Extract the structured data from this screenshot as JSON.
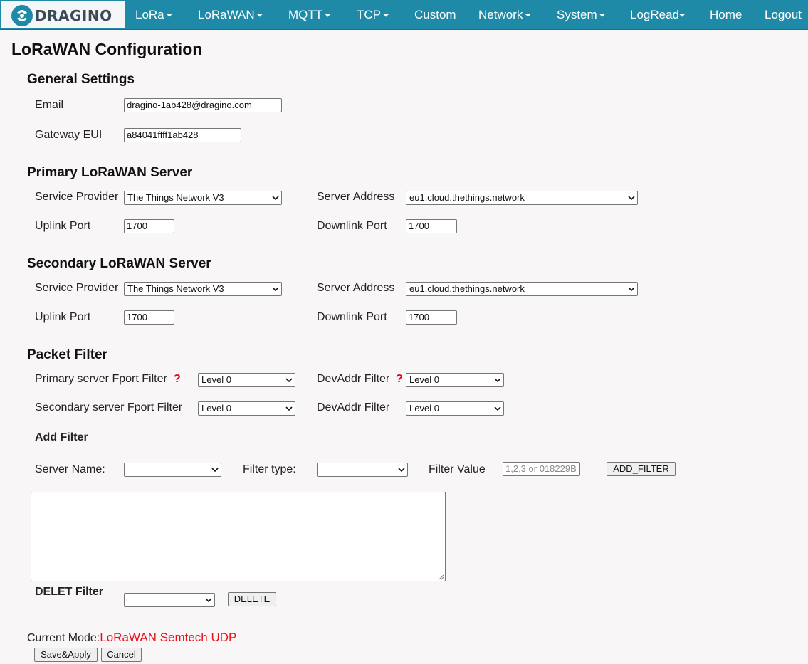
{
  "brand": {
    "logo_text": "DRAGINO"
  },
  "nav": {
    "items": [
      {
        "label": "LoRa",
        "dropdown": true
      },
      {
        "label": "LoRaWAN",
        "dropdown": true
      },
      {
        "label": "MQTT",
        "dropdown": true
      },
      {
        "label": "TCP",
        "dropdown": true
      },
      {
        "label": "Custom",
        "dropdown": false
      },
      {
        "label": "Network",
        "dropdown": true
      },
      {
        "label": "System",
        "dropdown": true
      },
      {
        "label": "LogRead",
        "dropdown": true
      },
      {
        "label": "Home",
        "dropdown": false
      },
      {
        "label": "Logout",
        "dropdown": false
      }
    ],
    "caret": "⏷"
  },
  "page": {
    "title": "LoRaWAN Configuration"
  },
  "general": {
    "title": "General Settings",
    "email_label": "Email",
    "email_value": "dragino-1ab428@dragino.com",
    "eui_label": "Gateway EUI",
    "eui_value": "a84041ffff1ab428"
  },
  "primary": {
    "title": "Primary LoRaWAN Server",
    "provider_label": "Service Provider",
    "provider_value": "The Things Network V3",
    "address_label": "Server Address",
    "address_value": "eu1.cloud.thethings.network",
    "uplink_label": "Uplink Port",
    "uplink_value": "1700",
    "downlink_label": "Downlink Port",
    "downlink_value": "1700"
  },
  "secondary": {
    "title": "Secondary LoRaWAN Server",
    "provider_label": "Service Provider",
    "provider_value": "The Things Network V3",
    "address_label": "Server Address",
    "address_value": "eu1.cloud.thethings.network",
    "uplink_label": "Uplink Port",
    "uplink_value": "1700",
    "downlink_label": "Downlink Port",
    "downlink_value": "1700"
  },
  "filter": {
    "title": "Packet Filter",
    "primary_fport_label": "Primary server Fport Filter",
    "primary_fport_value": "Level 0",
    "devaddr1_label": "DevAddr Filter",
    "devaddr1_value": "Level 0",
    "secondary_fport_label": "Secondary server Fport Filter",
    "secondary_fport_value": "Level 0",
    "devaddr2_label": "DevAddr Filter",
    "devaddr2_value": "Level 0",
    "help_mark": "?",
    "add_filter_title": "Add Filter",
    "server_name_label": "Server Name:",
    "server_name_value": "",
    "filter_type_label": "Filter type:",
    "filter_type_value": "",
    "filter_value_label": "Filter Value",
    "filter_value_placeholder": "1,2,3 or 018229B",
    "add_button": "ADD_FILTER",
    "delete_title": "DELET Filter",
    "delete_select_value": "",
    "delete_button": "DELETE"
  },
  "mode": {
    "label": "Current Mode:",
    "value": "LoRaWAN Semtech UDP"
  },
  "actions": {
    "save": "Save&Apply",
    "cancel": "Cancel"
  },
  "colors": {
    "nav_bg": "#1e8aa8",
    "page_bg": "#f8f6f7",
    "accent_red": "#e8101c"
  }
}
